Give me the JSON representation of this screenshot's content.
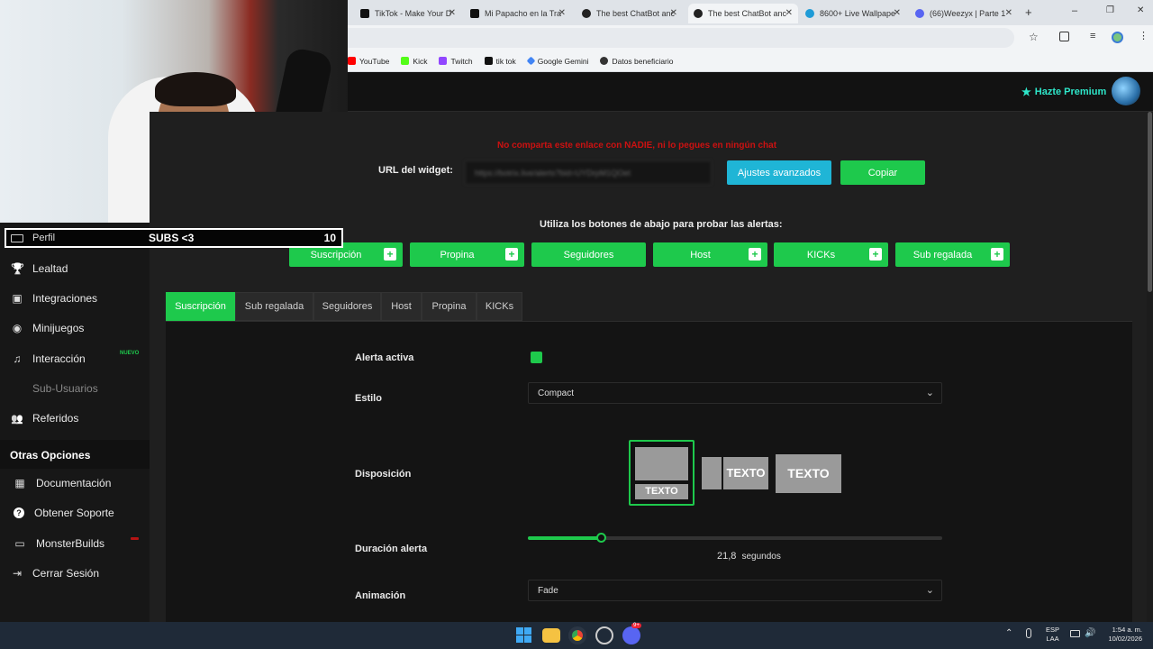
{
  "browser": {
    "tabs": [
      {
        "label": "TikTok - Make Your D",
        "color": "#111111",
        "active": false
      },
      {
        "label": "Mi Papacho en la Tra",
        "color": "#111111",
        "active": false
      },
      {
        "label": "The best ChatBot anc",
        "color": "#222222",
        "active": false
      },
      {
        "label": "The best ChatBot anc",
        "color": "#222222",
        "active": true
      },
      {
        "label": "8600+ Live Wallpape",
        "color": "#1e9bd7",
        "active": false
      },
      {
        "label": "(66)Weezyx | Parte 1",
        "color": "#5865f2",
        "active": false
      }
    ],
    "new_tab": "+",
    "win_min": "–",
    "win_max": "❐",
    "win_close": "✕",
    "bookmarks": [
      {
        "label": "YouTube",
        "color": "#ff0000"
      },
      {
        "label": "Kick",
        "color": "#53fc18"
      },
      {
        "label": "Twitch",
        "color": "#9146ff"
      },
      {
        "label": "tik tok",
        "color": "#111111"
      },
      {
        "label": "Google Gemini",
        "color": "#4285f4"
      },
      {
        "label": "Datos beneficiario",
        "color": "#333333"
      }
    ]
  },
  "overlay": {
    "label": "SUBS <3",
    "count": "10"
  },
  "header": {
    "premium_label": "Hazte Premium"
  },
  "sidebar": {
    "items": [
      {
        "label": "Perfil",
        "icon": "id-card-icon",
        "glyph": "▤"
      },
      {
        "label": "Lealtad",
        "icon": "trophy-icon",
        "glyph": "🏆"
      },
      {
        "label": "Integraciones",
        "icon": "plug-icon",
        "glyph": "▣"
      },
      {
        "label": "Minijuegos",
        "icon": "gamepad-icon",
        "glyph": "◉"
      },
      {
        "label": "Interacción",
        "icon": "music-icon",
        "glyph": "♫"
      },
      {
        "label": "Sub-Usuarios",
        "icon": "user-icon",
        "glyph": ""
      },
      {
        "label": "Referidos",
        "icon": "users-icon",
        "glyph": "👥"
      }
    ],
    "new_badge": "NUEVO",
    "section_title": "Otras Opciones",
    "other_items": [
      {
        "label": "Documentación",
        "icon": "book-icon",
        "glyph": "▦"
      },
      {
        "label": "Obtener Soporte",
        "icon": "question-icon",
        "glyph": "?"
      },
      {
        "label": "MonsterBuilds",
        "icon": "monitor-icon",
        "glyph": "▭"
      },
      {
        "label": "Cerrar Sesión",
        "icon": "logout-icon",
        "glyph": "⇥"
      }
    ]
  },
  "widget": {
    "warning": "No comparta este enlace con NADIE, ni lo pegues en ningún chat",
    "url_label": "URL del widget:",
    "url_value": "https://botrix.live/alerts?bid=UYDrpM1QOet",
    "advanced_button": "Ajustes avanzados",
    "copy_button": "Copiar",
    "test_instruction": "Utiliza los botones de abajo para probar las alertas:",
    "test_buttons": [
      "Suscripción",
      "Propina",
      "Seguidores",
      "Host",
      "KICKs",
      "Sub regalada"
    ]
  },
  "alert_tabs": [
    {
      "label": "Suscripción",
      "active": true
    },
    {
      "label": "Sub regalada",
      "active": false
    },
    {
      "label": "Seguidores",
      "active": false
    },
    {
      "label": "Host",
      "active": false
    },
    {
      "label": "Propina",
      "active": false
    },
    {
      "label": "KICKs",
      "active": false
    }
  ],
  "form": {
    "active_label": "Alerta activa",
    "active_checked": true,
    "style_label": "Estilo",
    "style_value": "Compact",
    "layout_label": "Disposición",
    "layout_text": "TEXTO",
    "duration_label": "Duración alerta",
    "duration_value": "21,8",
    "duration_unit": "segundos",
    "duration_fraction": 0.175,
    "animation_label": "Animación",
    "animation_value": "Fade"
  },
  "taskbar": {
    "lang_top": "ESP",
    "lang_bottom": "LAA",
    "time": "1:54 a. m.",
    "date": "10/02/2026",
    "discord_badge": "9+"
  },
  "colors": {
    "accent": "#1ec94c",
    "info": "#1fb5d6",
    "premium": "#2ee6c9",
    "warning": "#cc1111"
  }
}
